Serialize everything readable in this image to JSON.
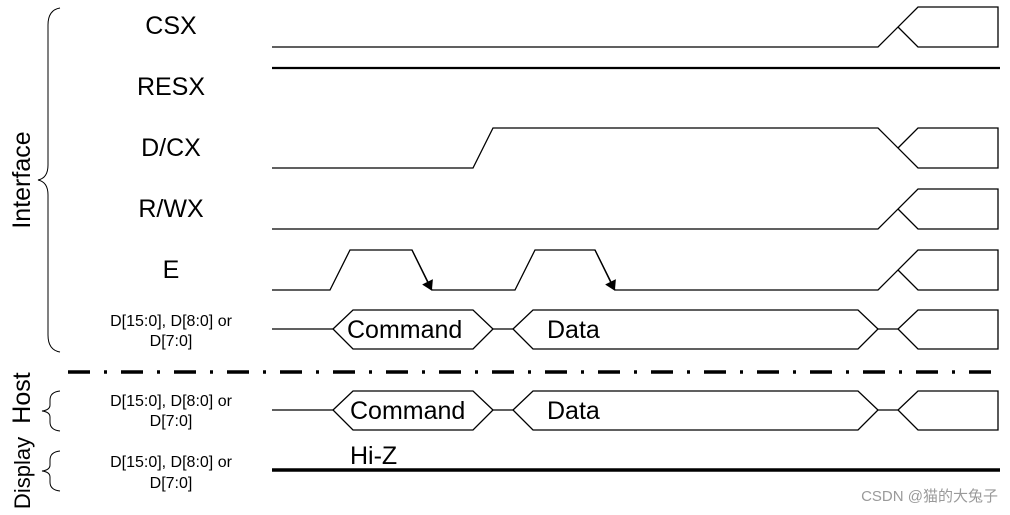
{
  "groups": {
    "interface": "Interface",
    "host": "Host",
    "display": "Display"
  },
  "signals": {
    "csx": "CSX",
    "resx": "RESX",
    "dcx": "D/CX",
    "rwx": "R/WX",
    "e": "E",
    "bus_line1": "D[15:0], D[8:0] or",
    "bus_line2": "D[7:0]"
  },
  "bus_values": {
    "command": "Command",
    "data": "Data",
    "hiz": "Hi-Z"
  },
  "watermark": "CSDN @猫的大兔子"
}
